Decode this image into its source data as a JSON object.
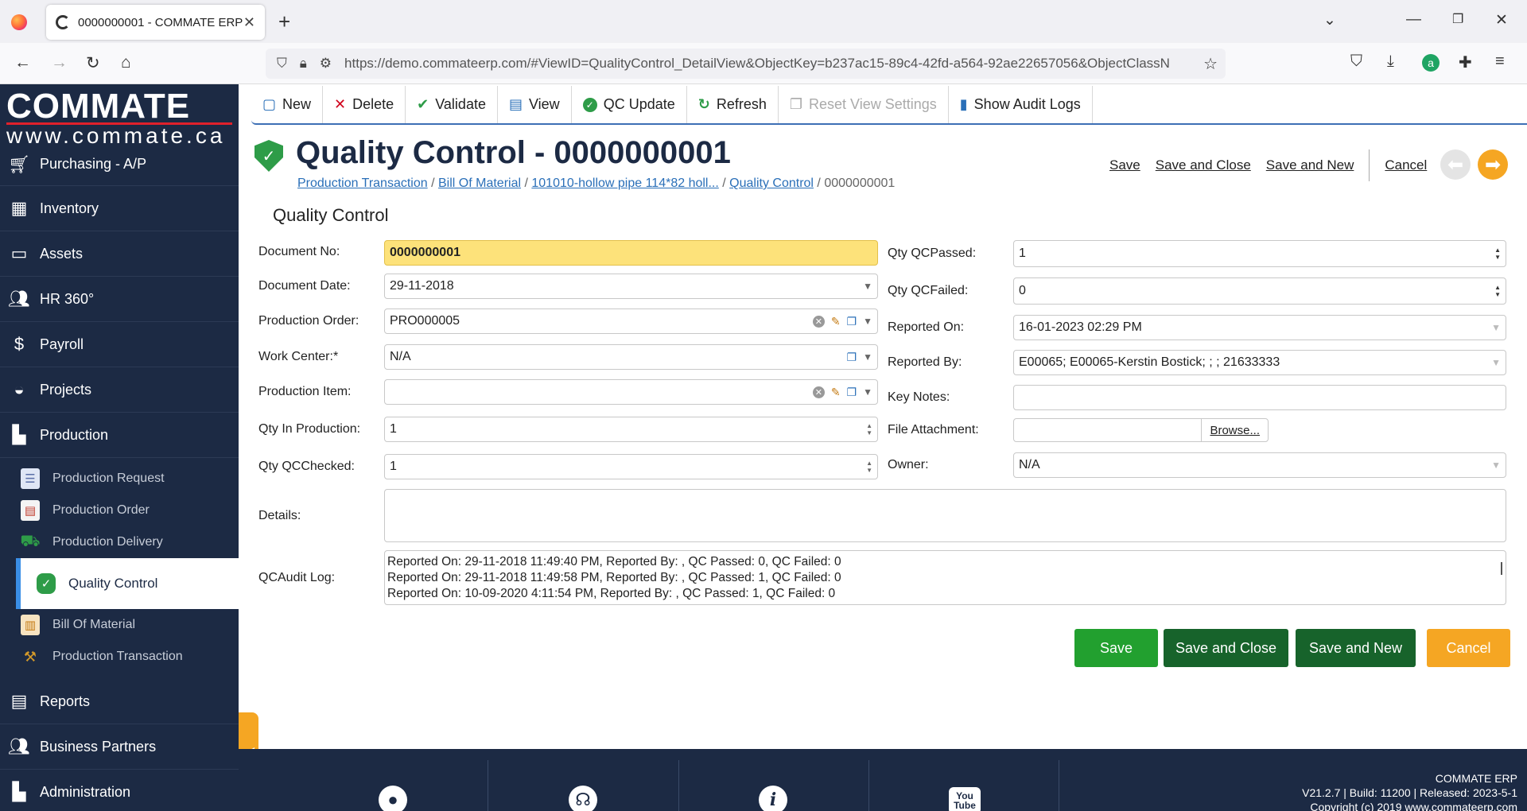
{
  "browser": {
    "tab_title": "0000000001 - COMMATE ERP",
    "url": "https://demo.commateerp.com/#ViewID=QualityControl_DetailView&ObjectKey=b237ac15-89c4-42fd-a564-92ae22657056&ObjectClassN"
  },
  "brand": {
    "name": "COMMATE",
    "url": "www.commate.ca"
  },
  "sidebar": {
    "items": [
      {
        "label": "Purchasing - A/P"
      },
      {
        "label": "Inventory"
      },
      {
        "label": "Assets"
      },
      {
        "label": "HR 360°"
      },
      {
        "label": "Payroll"
      },
      {
        "label": "Projects"
      },
      {
        "label": "Production"
      }
    ],
    "sub_items": [
      {
        "label": "Production Request"
      },
      {
        "label": "Production Order"
      },
      {
        "label": "Production Delivery"
      },
      {
        "label": "Quality Control"
      },
      {
        "label": "Bill Of Material"
      },
      {
        "label": "Production Transaction"
      }
    ],
    "bottom_items": [
      {
        "label": "Reports"
      },
      {
        "label": "Business Partners"
      },
      {
        "label": "Administration"
      }
    ]
  },
  "toolbar": {
    "new": "New",
    "delete": "Delete",
    "validate": "Validate",
    "view": "View",
    "qc_update": "QC Update",
    "refresh": "Refresh",
    "reset_view": "Reset View Settings",
    "audit_logs": "Show Audit Logs"
  },
  "header": {
    "title": "Quality Control - 0000000001",
    "breadcrumb": [
      "Production Transaction",
      "Bill Of Material",
      "101010-hollow pipe 114*82 holl...",
      "Quality Control",
      "0000000001"
    ],
    "links": {
      "save": "Save",
      "save_close": "Save and Close",
      "save_new": "Save and New",
      "cancel": "Cancel"
    }
  },
  "form": {
    "section_title": "Quality Control",
    "document_no": {
      "label": "Document No:",
      "value": "0000000001"
    },
    "document_date": {
      "label": "Document Date:",
      "value": "29-11-2018"
    },
    "production_order": {
      "label": "Production Order:",
      "value": "PRO000005"
    },
    "work_center": {
      "label": "Work Center:*",
      "value": "N/A"
    },
    "production_item": {
      "label": "Production Item:",
      "value": ""
    },
    "qty_in_production": {
      "label": "Qty In Production:",
      "value": "1"
    },
    "qty_qc_checked": {
      "label": "Qty QCChecked:",
      "value": "1"
    },
    "qty_qc_passed": {
      "label": "Qty QCPassed:",
      "value": "1"
    },
    "qty_qc_failed": {
      "label": "Qty QCFailed:",
      "value": "0"
    },
    "reported_on": {
      "label": "Reported On:",
      "value": "16-01-2023 02:29 PM"
    },
    "reported_by": {
      "label": "Reported By:",
      "value": "E00065; E00065-Kerstin Bostick; ; ; 21633333"
    },
    "key_notes": {
      "label": "Key Notes:",
      "value": ""
    },
    "file_attachment": {
      "label": "File Attachment:",
      "browse": "Browse..."
    },
    "owner": {
      "label": "Owner:",
      "value": "N/A"
    },
    "details": {
      "label": "Details:",
      "value": ""
    },
    "audit_log": {
      "label": "QCAudit Log:",
      "lines": [
        "Reported On: 29-11-2018 11:49:40 PM, Reported By: , QC Passed: 0, QC Failed: 0",
        "Reported On: 29-11-2018 11:49:58 PM, Reported By: , QC Passed: 1, QC Failed: 0",
        "Reported On: 10-09-2020 4:11:54 PM, Reported By: , QC Passed: 1, QC Failed: 0"
      ]
    }
  },
  "buttons": {
    "save": "Save",
    "save_close": "Save and Close",
    "save_new": "Save and New",
    "cancel": "Cancel"
  },
  "footer": {
    "youtube": "You Tube",
    "app": "COMMATE ERP",
    "version": "V21.2.7 | Build: 11200 | Released: 2023-5-1",
    "copyright": "Copyright (c) 2019 www.commateerp.com"
  },
  "colors": {
    "sidebar_bg": "#1c2a44",
    "accent_orange": "#f5a623",
    "save_green": "#22a02f",
    "dark_green": "#17632b",
    "highlight_yellow": "#fde27a"
  }
}
